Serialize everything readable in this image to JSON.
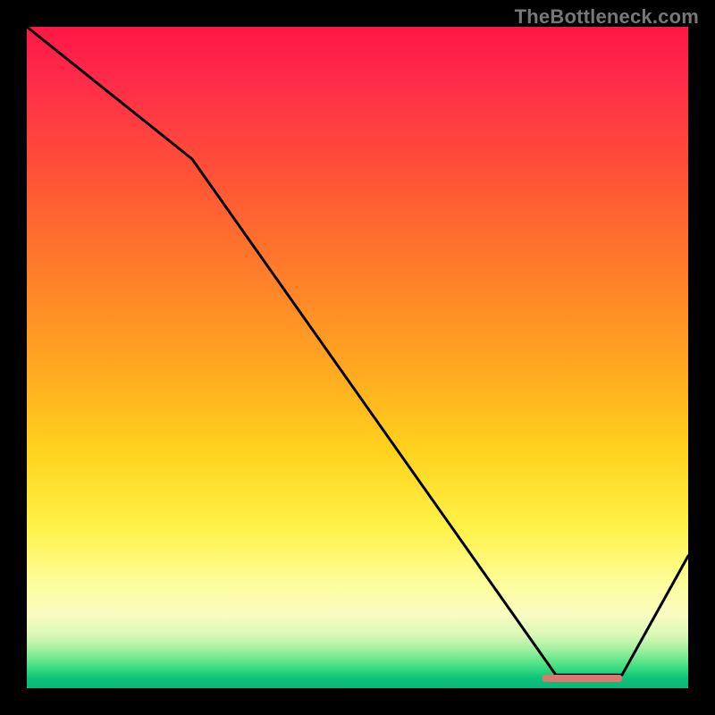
{
  "watermark": "TheBottleneck.com",
  "colors": {
    "frame_bg": "#000000",
    "line": "#000000",
    "marker": "#e2766e"
  },
  "chart_data": {
    "type": "line",
    "title": "",
    "xlabel": "",
    "ylabel": "",
    "xlim": [
      0,
      100
    ],
    "ylim": [
      0,
      100
    ],
    "x": [
      0,
      25,
      80,
      90,
      100
    ],
    "values": [
      100,
      80,
      2,
      2,
      20
    ],
    "marker": {
      "x_start": 78,
      "x_end": 90,
      "y": 1.5
    },
    "grid": false,
    "legend": false
  }
}
